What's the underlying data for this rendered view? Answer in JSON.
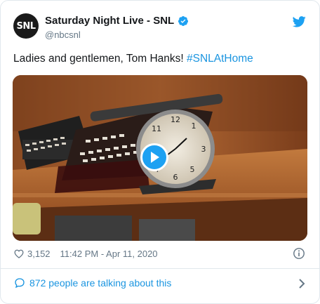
{
  "account": {
    "display_name": "Saturday Night Live - SNL",
    "handle": "@nbcsnl",
    "avatar_text": "SNL",
    "verified": true
  },
  "tweet": {
    "text_prefix": "Ladies and gentlemen, Tom Hanks! ",
    "hashtag": "#SNLAtHome"
  },
  "media": {
    "type": "video",
    "play_icon": "play-icon"
  },
  "meta": {
    "like_count": "3,152",
    "timestamp": "11:42 PM - Apr 11, 2020"
  },
  "conversation": {
    "label": "872 people are talking about this"
  },
  "colors": {
    "brand_blue": "#1da1f2",
    "link_blue": "#1b95e0",
    "muted_text": "#657786",
    "border": "#e1e8ed"
  }
}
